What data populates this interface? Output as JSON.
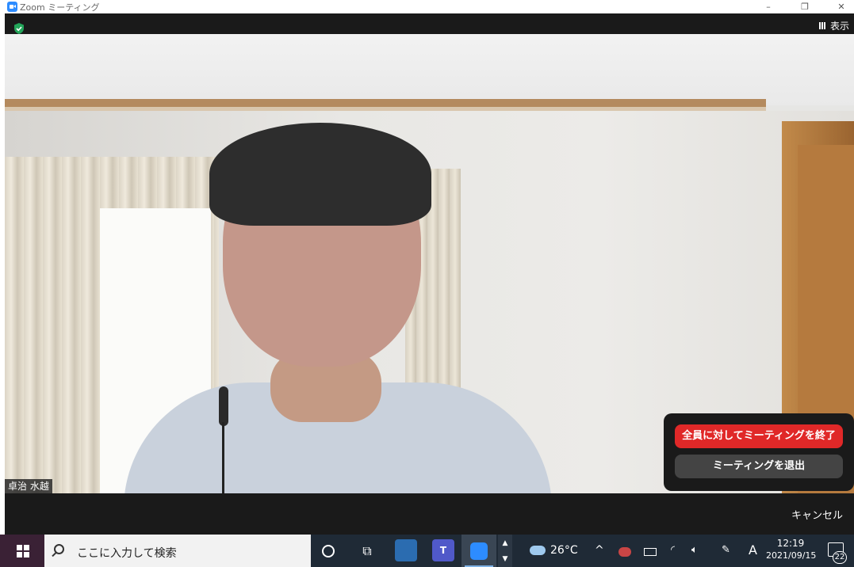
{
  "window": {
    "title": "Zoom ミーティング",
    "minimize": "–",
    "restore": "❐",
    "close": "✕"
  },
  "meeting": {
    "view_label": "表示",
    "participant_name": "卓治 水越",
    "security_icon": "shield-check-icon"
  },
  "end_popup": {
    "end_for_all_label": "全員に対してミーティングを終了",
    "leave_label": "ミーティングを退出",
    "cancel_label": "キャンセル",
    "end_color": "#e02828",
    "leave_color": "#444444"
  },
  "taskbar": {
    "search_placeholder": "ここに入力して検索",
    "weather_temp": "26°C",
    "ime_label": "A",
    "time": "12:19",
    "date": "2021/09/15",
    "notification_count": "22",
    "teams_letter": "T",
    "tray_chevron": "^"
  }
}
